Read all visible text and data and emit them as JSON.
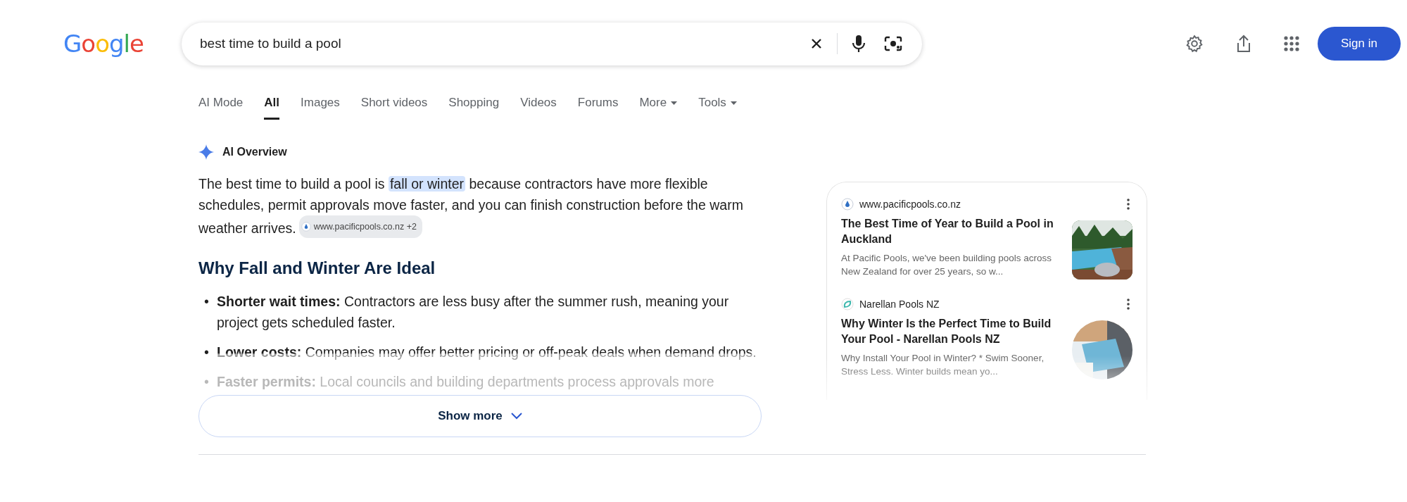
{
  "logo": "Google",
  "search": {
    "value": "best time to build a pool"
  },
  "header_actions": {
    "sign_in": "Sign in"
  },
  "tabs": [
    {
      "label": "AI Mode",
      "selected": false,
      "dropdown": false
    },
    {
      "label": "All",
      "selected": true,
      "dropdown": false
    },
    {
      "label": "Images",
      "selected": false,
      "dropdown": false
    },
    {
      "label": "Short videos",
      "selected": false,
      "dropdown": false
    },
    {
      "label": "Shopping",
      "selected": false,
      "dropdown": false
    },
    {
      "label": "Videos",
      "selected": false,
      "dropdown": false
    },
    {
      "label": "Forums",
      "selected": false,
      "dropdown": false
    },
    {
      "label": "More",
      "selected": false,
      "dropdown": true
    },
    {
      "label": "Tools",
      "selected": false,
      "dropdown": true
    }
  ],
  "ai_overview": {
    "title": "AI Overview",
    "summary": [
      {
        "text": "The best time to build a pool is ",
        "highlighted": false
      },
      {
        "text": "fall or winter",
        "highlighted": true
      },
      {
        "text": " because contractors have more flexible schedules, permit approvals move faster, and you can finish construction before the warm weather arrives.",
        "highlighted": false
      }
    ],
    "citation": "www.pacificpools.co.nz +2",
    "heading": "Why Fall and Winter Are Ideal",
    "bullets": [
      {
        "marker": "•",
        "text": "**Shorter wait times:** Contractors are less busy after the summer rush, meaning your project gets scheduled faster."
      },
      {
        "marker": "•",
        "text": "**Lower costs:** Companies may offer better pricing or off-peak deals when demand drops."
      },
      {
        "marker": "•",
        "text": "**Faster permits:** Local councils and building departments process approvals more"
      }
    ],
    "show_more": "Show more",
    "sources": [
      {
        "site": "www.pacificpools.co.nz",
        "title": "The Best Time of Year to Build a Pool in Auckland",
        "snippet": "At Pacific Pools, we've been building pools across New Zealand for over 25 years, so w..."
      },
      {
        "site": "Narellan Pools NZ",
        "title": "Why Winter Is the Perfect Time to Build Your Pool - Narellan Pools NZ",
        "snippet": "Why Install Your Pool in Winter? * Swim Sooner, Stress Less. Winter builds mean yo..."
      }
    ]
  }
}
